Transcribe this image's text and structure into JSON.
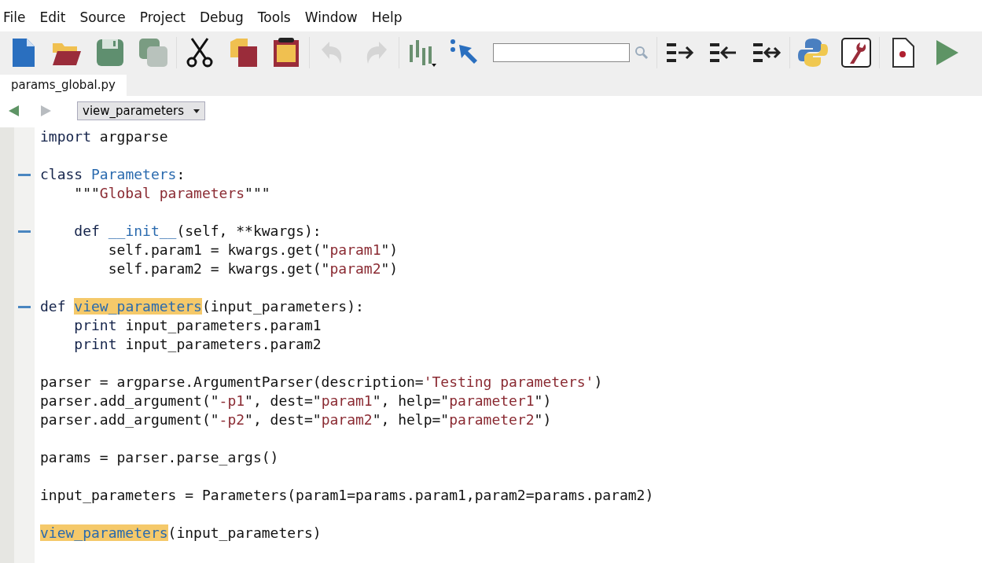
{
  "menu": [
    {
      "label": "File"
    },
    {
      "label": "Edit"
    },
    {
      "label": "Source"
    },
    {
      "label": "Project"
    },
    {
      "label": "Debug"
    },
    {
      "label": "Tools"
    },
    {
      "label": "Window"
    },
    {
      "label": "Help"
    }
  ],
  "toolbar": [
    {
      "kind": "new",
      "disabled": false
    },
    {
      "kind": "open",
      "disabled": false
    },
    {
      "kind": "save",
      "disabled": false
    },
    {
      "kind": "saveall",
      "disabled": false
    },
    {
      "kind": "sep"
    },
    {
      "kind": "cut",
      "disabled": false
    },
    {
      "kind": "copy",
      "disabled": false
    },
    {
      "kind": "paste",
      "disabled": false
    },
    {
      "kind": "sep"
    },
    {
      "kind": "undo",
      "disabled": true
    },
    {
      "kind": "redo",
      "disabled": true
    },
    {
      "kind": "sep"
    },
    {
      "kind": "bars",
      "disabled": false
    },
    {
      "kind": "pointer",
      "disabled": false
    },
    {
      "kind": "search"
    },
    {
      "kind": "sep"
    },
    {
      "kind": "indent",
      "disabled": false
    },
    {
      "kind": "dedent",
      "disabled": false
    },
    {
      "kind": "swap",
      "disabled": false
    },
    {
      "kind": "sep"
    },
    {
      "kind": "python",
      "disabled": false
    },
    {
      "kind": "wrench",
      "disabled": false
    },
    {
      "kind": "sep"
    },
    {
      "kind": "record",
      "disabled": false
    },
    {
      "kind": "run",
      "disabled": false
    }
  ],
  "tabs": [
    {
      "label": "params_global.py",
      "selected": true
    }
  ],
  "navigation": {
    "back_disabled": false,
    "forward_disabled": true,
    "function_dropdown": "view_parameters"
  },
  "code_lines": [
    {
      "fold": false,
      "tokens": [
        {
          "kind": "kw",
          "text": "import"
        },
        {
          "kind": "plain",
          "text": " argparse"
        }
      ]
    },
    {
      "fold": false
    },
    {
      "fold": true,
      "tokens": [
        {
          "kind": "kw",
          "text": "class "
        },
        {
          "kind": "name",
          "text": "Parameters"
        },
        {
          "kind": "plain",
          "text": ":"
        }
      ]
    },
    {
      "fold": false,
      "tokens": [
        {
          "kind": "plain",
          "text": "    \"\"\""
        },
        {
          "kind": "str",
          "text": "Global parameters"
        },
        {
          "kind": "plain",
          "text": "\"\"\""
        }
      ]
    },
    {
      "fold": false
    },
    {
      "fold": true,
      "tokens": [
        {
          "kind": "kw",
          "text": "    def "
        },
        {
          "kind": "name",
          "text": "__init__"
        },
        {
          "kind": "plain",
          "text": "(self, **kwargs):"
        }
      ]
    },
    {
      "fold": false,
      "tokens": [
        {
          "kind": "plain",
          "text": "        self.param1 = kwargs.get(\""
        },
        {
          "kind": "str",
          "text": "param1"
        },
        {
          "kind": "plain",
          "text": "\")"
        }
      ]
    },
    {
      "fold": false,
      "tokens": [
        {
          "kind": "plain",
          "text": "        self.param2 = kwargs.get(\""
        },
        {
          "kind": "str",
          "text": "param2"
        },
        {
          "kind": "plain",
          "text": "\")"
        }
      ]
    },
    {
      "fold": false
    },
    {
      "fold": true,
      "tokens": [
        {
          "kind": "kw",
          "text": "def "
        },
        {
          "kind": "match",
          "text": "view_parameters"
        },
        {
          "kind": "plain",
          "text": "(input_parameters):"
        }
      ]
    },
    {
      "fold": false,
      "tokens": [
        {
          "kind": "kw",
          "text": "    print"
        },
        {
          "kind": "plain",
          "text": " input_parameters.param1"
        }
      ]
    },
    {
      "fold": false,
      "tokens": [
        {
          "kind": "kw",
          "text": "    print"
        },
        {
          "kind": "plain",
          "text": " input_parameters.param2"
        }
      ]
    },
    {
      "fold": false
    },
    {
      "fold": false,
      "tokens": [
        {
          "kind": "plain",
          "text": "parser = argparse.ArgumentParser(description="
        },
        {
          "kind": "str",
          "text": "'Testing parameters'"
        },
        {
          "kind": "plain",
          "text": ")"
        }
      ]
    },
    {
      "fold": false,
      "tokens": [
        {
          "kind": "plain",
          "text": "parser.add_argument(\""
        },
        {
          "kind": "str",
          "text": "-p1"
        },
        {
          "kind": "plain",
          "text": "\", dest=\""
        },
        {
          "kind": "str",
          "text": "param1"
        },
        {
          "kind": "plain",
          "text": "\", help=\""
        },
        {
          "kind": "str",
          "text": "parameter1"
        },
        {
          "kind": "plain",
          "text": "\")"
        }
      ]
    },
    {
      "fold": false,
      "tokens": [
        {
          "kind": "plain",
          "text": "parser.add_argument(\""
        },
        {
          "kind": "str",
          "text": "-p2"
        },
        {
          "kind": "plain",
          "text": "\", dest=\""
        },
        {
          "kind": "str",
          "text": "param2"
        },
        {
          "kind": "plain",
          "text": "\", help=\""
        },
        {
          "kind": "str",
          "text": "parameter2"
        },
        {
          "kind": "plain",
          "text": "\")"
        }
      ]
    },
    {
      "fold": false
    },
    {
      "fold": false,
      "tokens": [
        {
          "kind": "plain",
          "text": "params = parser.parse_args()"
        }
      ]
    },
    {
      "fold": false
    },
    {
      "fold": false,
      "tokens": [
        {
          "kind": "plain",
          "text": "input_parameters = Parameters(param1=params.param1,param2=params.param2)"
        }
      ]
    },
    {
      "fold": false
    },
    {
      "fold": false,
      "tokens": [
        {
          "kind": "match",
          "text": "view_parameters"
        },
        {
          "kind": "plain",
          "text": "(input_parameters)"
        }
      ]
    }
  ]
}
